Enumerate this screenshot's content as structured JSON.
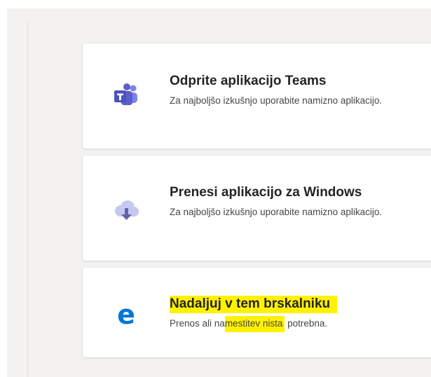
{
  "cards": [
    {
      "icon": "teams-icon",
      "title": "Odprite aplikacijo Teams",
      "description": "Za najboljšo izkušnjo uporabite namizno aplikacijo."
    },
    {
      "icon": "cloud-download-icon",
      "title": "Prenesi aplikacijo za Windows",
      "description": "Za najboljšo izkušnjo uporabite namizno aplikacijo."
    },
    {
      "icon": "edge-browser-icon",
      "title": "Nadaljuj v tem brskalniku",
      "description_prefix": "Prenos ali na",
      "description_highlight": "mestitev nista",
      "description_suffix": " potrebna."
    }
  ],
  "colors": {
    "page_background": "#f3f2f1",
    "card_background": "#ffffff",
    "teams_purple": "#5b5fc7",
    "teams_purple_light": "#7b83eb",
    "cloud_lavender": "#c5c8f1",
    "arrow_purple": "#6264a7",
    "edge_blue": "#0078d7",
    "highlight_yellow": "#fff200"
  }
}
